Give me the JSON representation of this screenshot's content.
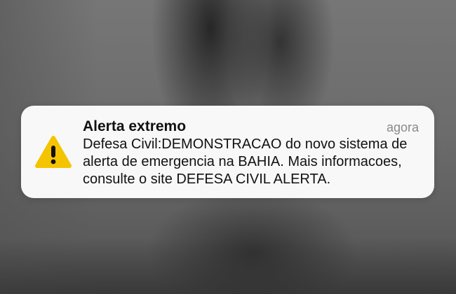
{
  "notification": {
    "title": "Alerta extremo",
    "time": "agora",
    "icon": "warning-triangle-icon",
    "accent_color": "#F5C400",
    "body_lines": [
      "Defesa Civil:DEMONSTRACAO do novo sistema de",
      "alerta de emergencia na BAHIA. Mais informacoes,",
      "consulte o site DEFESA CIVIL ALERTA."
    ]
  }
}
